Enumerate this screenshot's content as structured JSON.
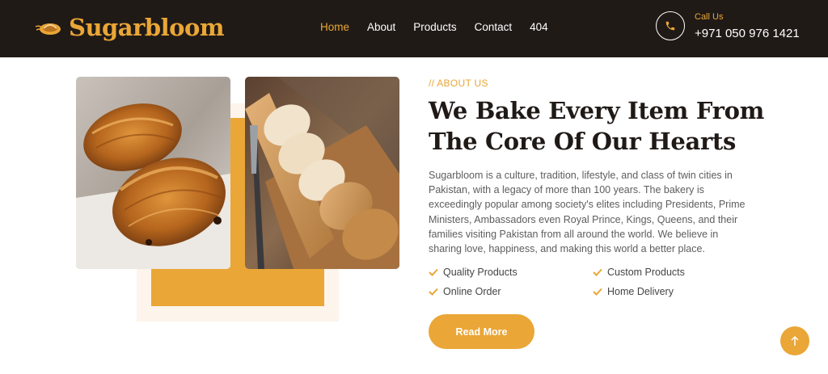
{
  "brand": {
    "name": "Sugarbloom",
    "logo_icon": "pastry-logo-icon",
    "accent_color": "#eaa636",
    "dark_color": "#201a17"
  },
  "nav": {
    "items": [
      {
        "label": "Home",
        "active": true
      },
      {
        "label": "About",
        "active": false
      },
      {
        "label": "Products",
        "active": false
      },
      {
        "label": "Contact",
        "active": false
      },
      {
        "label": "404",
        "active": false
      }
    ]
  },
  "contact": {
    "icon": "phone-icon",
    "label": "Call Us",
    "number": "+971 050 976 1421"
  },
  "about": {
    "subtitle": "// ABOUT US",
    "title": "We Bake Every Item From The Core Of Our Hearts",
    "description": "Sugarbloom is a culture, tradition, lifestyle, and class of twin cities in Pakistan, with a legacy of more than 100 years. The bakery is exceedingly popular among society's elites including Presidents, Prime Ministers, Ambassadors even Royal Prince, Kings, Queens, and their families visiting Pakistan from all around the world. We believe in sharing love, happiness, and making this world a better place.",
    "features": [
      "Quality Products",
      "Custom Products",
      "Online Order",
      "Home Delivery"
    ],
    "button_label": "Read More"
  },
  "images": [
    "croissant-photo",
    "bread-loaf-photo"
  ],
  "scroll_top": {
    "icon": "arrow-up-icon"
  }
}
